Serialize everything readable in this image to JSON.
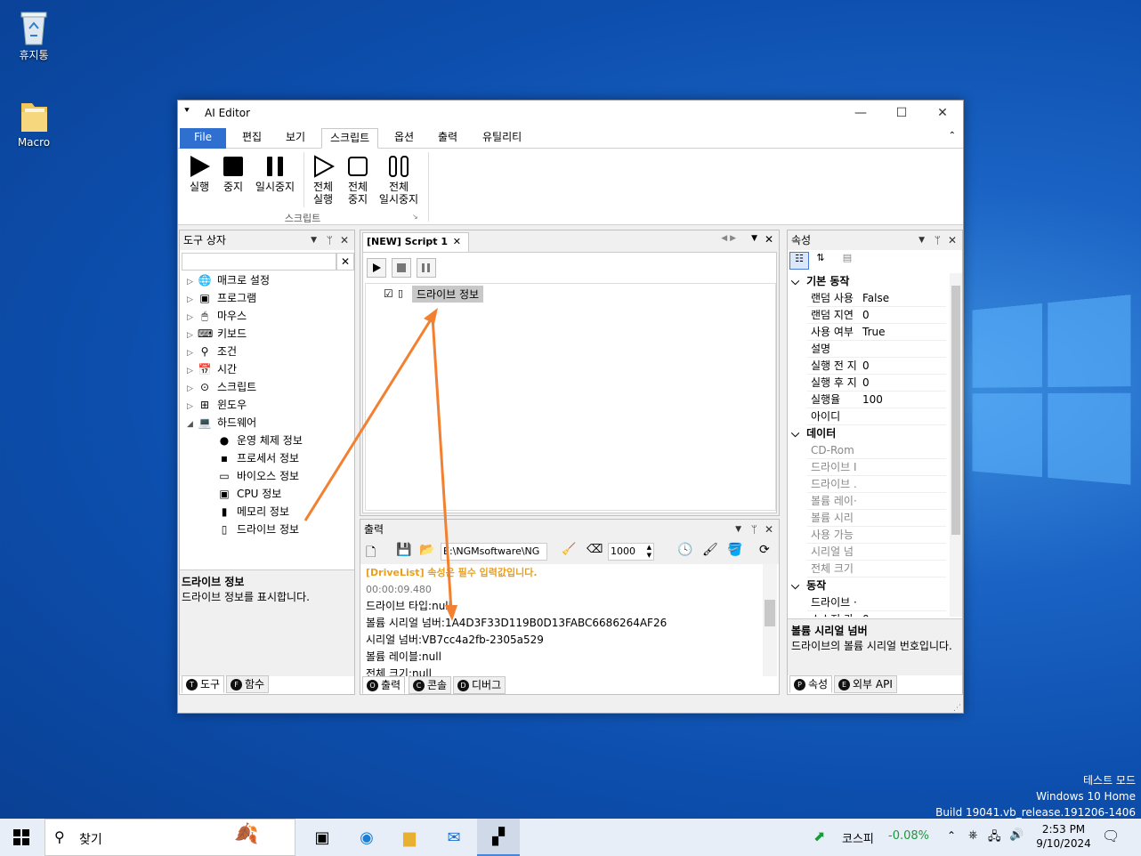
{
  "desktop": {
    "icons": [
      {
        "label": "휴지통",
        "icon": "recycle-bin-icon"
      },
      {
        "label": "Macro",
        "icon": "folder-icon"
      }
    ],
    "watermark": [
      "테스트 모드",
      "Windows 10 Home",
      "Build 19041.vb_release.191206-1406"
    ]
  },
  "window": {
    "title": "AI Editor",
    "controls": [
      "—",
      "☐",
      "✕"
    ],
    "tabs": [
      "File",
      "편집",
      "보기",
      "스크립트",
      "옵션",
      "출력",
      "유틸리티"
    ],
    "active_tab": "스크립트",
    "ribbon": {
      "buttons": [
        {
          "label1": "실행",
          "label2": ""
        },
        {
          "label1": "중지",
          "label2": ""
        },
        {
          "label1": "일시중지",
          "label2": ""
        },
        {
          "label1": "전체",
          "label2": "실행"
        },
        {
          "label1": "전체",
          "label2": "중지"
        },
        {
          "label1": "전체",
          "label2": "일시중지"
        }
      ],
      "group_label": "스크립트"
    },
    "toolbox": {
      "title": "도구 상자",
      "search_placeholder": "",
      "items": [
        {
          "label": "매크로 설정",
          "icon": "globe-icon",
          "expander": "▷"
        },
        {
          "label": "프로그램",
          "icon": "program-icon",
          "expander": "▷"
        },
        {
          "label": "마우스",
          "icon": "mouse-icon",
          "expander": "▷"
        },
        {
          "label": "키보드",
          "icon": "keyboard-icon",
          "expander": "▷"
        },
        {
          "label": "조건",
          "icon": "condition-icon",
          "expander": "▷"
        },
        {
          "label": "시간",
          "icon": "calendar-icon",
          "expander": "▷"
        },
        {
          "label": "스크립트",
          "icon": "script-icon",
          "expander": "▷"
        },
        {
          "label": "윈도우",
          "icon": "windows-icon",
          "expander": "▷"
        },
        {
          "label": "하드웨어",
          "icon": "computer-icon",
          "expander": "◢"
        }
      ],
      "children": [
        {
          "label": "운영 체제 정보",
          "icon": "os-icon"
        },
        {
          "label": "프로세서 정보",
          "icon": "cpu-chip-icon"
        },
        {
          "label": "바이오스 정보",
          "icon": "bios-icon"
        },
        {
          "label": "CPU 정보",
          "icon": "cpu-icon"
        },
        {
          "label": "메모리 정보",
          "icon": "memory-icon"
        },
        {
          "label": "드라이브 정보",
          "icon": "drive-icon"
        }
      ],
      "desc_title": "드라이브 정보",
      "desc_text": "드라이브 정보를 표시합니다.",
      "tabs": [
        {
          "letter": "T",
          "label": "도구"
        },
        {
          "letter": "F",
          "label": "함수"
        }
      ]
    },
    "editor": {
      "tab_title": "[NEW] Script 1",
      "node_label": "드라이브 정보"
    },
    "output": {
      "title": "출력",
      "path": "E:\\NGMsoftware\\NG",
      "count": "1000",
      "lines": [
        {
          "text": "[DriveList] 속성은 필수 입력값입니다.",
          "color": "#e8a020"
        },
        {
          "text": "00:00:09.480",
          "color": "#777777"
        },
        {
          "text": "드라이브 타입:null",
          "color": "#000000"
        },
        {
          "text": "볼륨 시리얼 넘버:1A4D3F33D119B0D13FABC6686264AF26",
          "color": "#000000"
        },
        {
          "text": "시리얼 넘버:VB7cc4a2fb-2305a529",
          "color": "#000000"
        },
        {
          "text": "볼륨 레이블:null",
          "color": "#000000"
        },
        {
          "text": "전체 크기:null",
          "color": "#000000"
        }
      ],
      "tabs": [
        {
          "letter": "O",
          "label": "출력"
        },
        {
          "letter": "C",
          "label": "콘솔"
        },
        {
          "letter": "D",
          "label": "디버그"
        }
      ]
    },
    "properties": {
      "title": "속성",
      "categories": [
        {
          "name": "기본 동작",
          "rows": [
            {
              "k": "랜덤 사용",
              "v": "False"
            },
            {
              "k": "랜덤 지연",
              "v": "0"
            },
            {
              "k": "사용 여부",
              "v": "True"
            },
            {
              "k": "설명",
              "v": ""
            },
            {
              "k": "실행 전 지",
              "v": "0"
            },
            {
              "k": "실행 후 지",
              "v": "0"
            },
            {
              "k": "실행율",
              "v": "100"
            },
            {
              "k": "아이디",
              "v": ""
            }
          ]
        },
        {
          "name": "데이터",
          "rows": [
            {
              "k": "CD-Rom",
              "v": ""
            },
            {
              "k": "드라이브 I",
              "v": ""
            },
            {
              "k": "드라이브 .",
              "v": ""
            },
            {
              "k": "볼륨 레이·",
              "v": ""
            },
            {
              "k": "볼륨 시리",
              "v": ""
            },
            {
              "k": "사용 가능",
              "v": ""
            },
            {
              "k": "시리얼 넘",
              "v": ""
            },
            {
              "k": "전체 크기",
              "v": ""
            }
          ]
        },
        {
          "name": "동작",
          "rows": [
            {
              "k": "드라이브 ·",
              "v": ""
            },
            {
              "k": "소스저 카",
              "v": "0"
            }
          ]
        }
      ],
      "desc_title": "볼륨 시리얼 넘버",
      "desc_text": "드라이브의 볼륨 시리얼 번호입니다.",
      "tabs": [
        {
          "letter": "P",
          "label": "속성"
        },
        {
          "letter": "E",
          "label": "외부 API"
        }
      ]
    }
  },
  "taskbar": {
    "search_placeholder": "찾기",
    "stock_name": "코스피",
    "stock_change": "-0.08%",
    "time": "2:53 PM",
    "date": "9/10/2024"
  },
  "colors": {
    "arrow": "#f28030",
    "accent": "#2f6fd0",
    "stock": "#1a9a3a"
  }
}
